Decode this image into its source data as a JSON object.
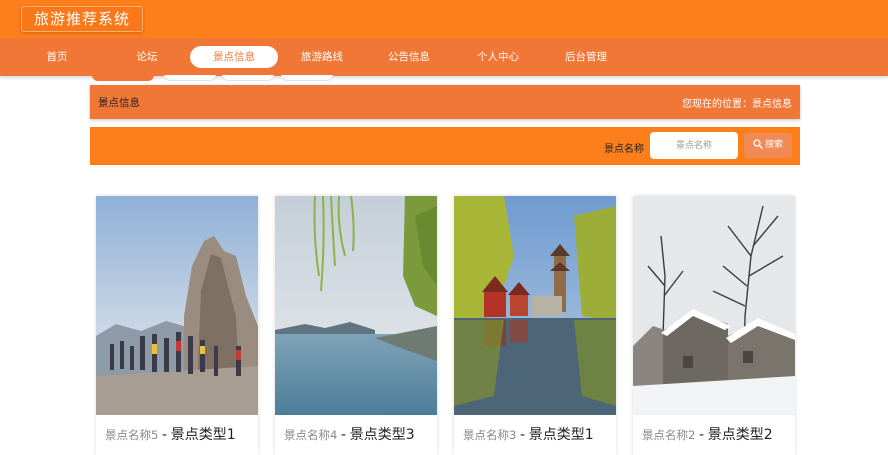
{
  "app": {
    "title": "旅游推荐系统"
  },
  "nav": {
    "items": [
      {
        "label": "首页"
      },
      {
        "label": "论坛"
      },
      {
        "label": "景点信息",
        "active": true
      },
      {
        "label": "旅游路线"
      },
      {
        "label": "公告信息"
      },
      {
        "label": "个人中心"
      },
      {
        "label": "后台管理"
      }
    ]
  },
  "breadcrumb": {
    "title": "景点信息",
    "location": "您现在的位置：景点信息"
  },
  "search": {
    "label": "景点名称",
    "placeholder": "景点名称",
    "value": "",
    "button_label": "搜索"
  },
  "cards": [
    {
      "name": "景点名称5",
      "separator": "-",
      "type": "景点类型1"
    },
    {
      "name": "景点名称4",
      "separator": "-",
      "type": "景点类型3"
    },
    {
      "name": "景点名称3",
      "separator": "-",
      "type": "景点类型1"
    },
    {
      "name": "景点名称2",
      "separator": "-",
      "type": "景点类型2"
    }
  ],
  "colors": {
    "topbar": "#fd7f1c",
    "navbar": "#f07736",
    "accent": "#f07736"
  },
  "icons": {
    "search": "search-icon"
  }
}
